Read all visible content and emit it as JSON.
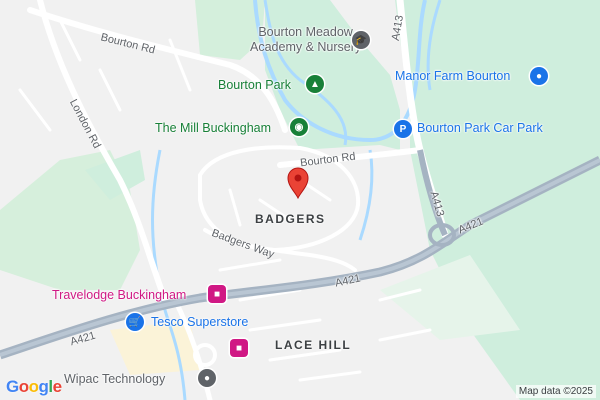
{
  "map": {
    "roads": {
      "bourton_rd_west": "Bourton Rd",
      "bourton_rd_east": "Bourton Rd",
      "london_rd": "London Rd",
      "a413_north": "A413",
      "a413_south": "A413",
      "a421_east": "A421",
      "a421_mid": "A421",
      "a421_west": "A421",
      "badgers_way": "Badgers Way"
    },
    "areas": {
      "badgers": "BADGERS",
      "lace_hill": "LACE HILL"
    },
    "pois": {
      "school": {
        "line1": "Bourton Meadow",
        "line2": "Academy & Nursery",
        "icon": "school-icon",
        "color": "#5f6368"
      },
      "park": {
        "label": "Bourton Park",
        "icon": "tree-icon",
        "color": "#188038"
      },
      "mill": {
        "label": "The Mill Buckingham",
        "icon": "camera-icon",
        "color": "#188038"
      },
      "carpark": {
        "label": "Bourton Park Car Park",
        "icon": "parking-icon",
        "color": "#1a73e8"
      },
      "manor": {
        "label": "Manor Farm Bourton",
        "icon": "lock-bag-icon",
        "color": "#1a73e8"
      },
      "travelodge": {
        "label": "Travelodge Buckingham",
        "icon": "bed-icon",
        "color": "#d01884"
      },
      "hotel_small": {
        "icon": "bed-icon",
        "color": "#d01884"
      },
      "tesco": {
        "label": "Tesco Superstore",
        "icon": "cart-icon",
        "color": "#1a73e8"
      },
      "wipac": {
        "label": "Wipac Technology",
        "icon": "pin-icon",
        "color": "#5f6368"
      }
    },
    "marker": {
      "icon": "map-marker-icon",
      "color": "#ea4335"
    },
    "attribution": "Map data ©2025",
    "logo": "Google",
    "colors": {
      "background": "#f1f1f1",
      "park": "#cfeedd",
      "woodland": "#c8e6c9",
      "water": "#aadaff",
      "trunk_road": "#a5b3c2",
      "minor_road": "#ffffff"
    }
  }
}
